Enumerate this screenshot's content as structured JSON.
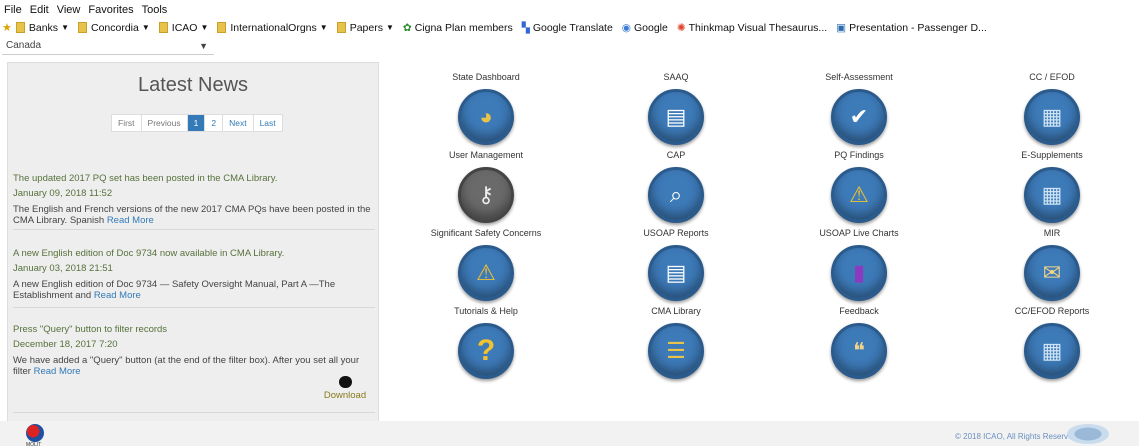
{
  "browser": {
    "menu": [
      "File",
      "Edit",
      "View",
      "Favorites",
      "Tools"
    ],
    "favorites": [
      {
        "label": "Banks",
        "type": "folder",
        "dropdown": true
      },
      {
        "label": "Concordia",
        "type": "folder",
        "dropdown": true
      },
      {
        "label": "ICAO",
        "type": "folder",
        "dropdown": true
      },
      {
        "label": "InternationalOrgns",
        "type": "folder",
        "dropdown": true
      },
      {
        "label": "Papers",
        "type": "folder",
        "dropdown": true
      },
      {
        "label": "Cigna  Plan members",
        "type": "link"
      },
      {
        "label": "Google Translate",
        "type": "link"
      },
      {
        "label": "Google",
        "type": "link"
      },
      {
        "label": "Thinkmap Visual Thesaurus...",
        "type": "link"
      },
      {
        "label": "Presentation - Passenger D...",
        "type": "link"
      }
    ]
  },
  "country_select": {
    "value": "Canada"
  },
  "news": {
    "title": "Latest News",
    "pager": {
      "first": "First",
      "previous": "Previous",
      "pages": [
        "1",
        "2"
      ],
      "active_page": "1",
      "next": "Next",
      "last": "Last"
    },
    "items": [
      {
        "headline": "The updated 2017 PQ set has been posted in the CMA Library.",
        "date": "January 09, 2018 11:52",
        "body": "The English and French versions of the new 2017 CMA PQs have been posted in the CMA Library. Spanish",
        "more": "Read More"
      },
      {
        "headline": "A new English edition of Doc 9734 now available in CMA Library.",
        "date": "January 03, 2018 21:51",
        "body": "A new English edition of Doc 9734 — Safety Oversight Manual, Part A —The Establishment and",
        "more": "Read More"
      },
      {
        "headline": "Press \"Query\" button to filter records",
        "date": "December 18, 2017 7:20",
        "body": "We have added a \"Query\" button (at the end of the filter box). After you set all your filter",
        "more": "Read More"
      }
    ],
    "download_label": "Download"
  },
  "tiles": [
    {
      "label": "State Dashboard",
      "icon": "pie-chart-icon",
      "glyph": "◕",
      "color": "#3d7ab8"
    },
    {
      "label": "SAAQ",
      "icon": "document-icon",
      "glyph": "▤",
      "color": "#3d7ab8"
    },
    {
      "label": "Self-Assessment",
      "icon": "checkmark-icon",
      "glyph": "✔",
      "color": "#3d7ab8"
    },
    {
      "label": "CC / EFOD",
      "icon": "calculator-icon",
      "glyph": "▦",
      "color": "#3d7ab8"
    },
    {
      "label": "User Management",
      "icon": "key-icon",
      "glyph": "⚷",
      "color": "#6a6a6a"
    },
    {
      "label": "CAP",
      "icon": "magnifier-icon",
      "glyph": "⌕",
      "color": "#3d7ab8"
    },
    {
      "label": "PQ Findings",
      "icon": "warning-icon",
      "glyph": "⚠",
      "color": "#3d7ab8"
    },
    {
      "label": "E-Supplements",
      "icon": "calculator-icon",
      "glyph": "▦",
      "color": "#3d7ab8"
    },
    {
      "label": "Significant Safety Concerns",
      "icon": "warning-icon",
      "glyph": "⚠",
      "color": "#3d7ab8"
    },
    {
      "label": "USOAP Reports",
      "icon": "report-icon",
      "glyph": "▤",
      "color": "#3d7ab8"
    },
    {
      "label": "USOAP Live Charts",
      "icon": "bar-chart-icon",
      "glyph": "▮",
      "color": "#3d7ab8"
    },
    {
      "label": "MIR",
      "icon": "envelope-icon",
      "glyph": "✉",
      "color": "#3d7ab8"
    },
    {
      "label": "Tutorials & Help",
      "icon": "question-icon",
      "glyph": "?",
      "color": "#3d7ab8"
    },
    {
      "label": "CMA Library",
      "icon": "books-icon",
      "glyph": "☰",
      "color": "#3d7ab8"
    },
    {
      "label": "Feedback",
      "icon": "chat-bubbles-icon",
      "glyph": "❝",
      "color": "#3d7ab8"
    },
    {
      "label": "CC/EFOD Reports",
      "icon": "calculator-icon",
      "glyph": "▦",
      "color": "#3d7ab8"
    }
  ],
  "footer": {
    "moe_text": "MOLIT",
    "copyright": "© 2018 ICAO, All Rights Reserved"
  }
}
